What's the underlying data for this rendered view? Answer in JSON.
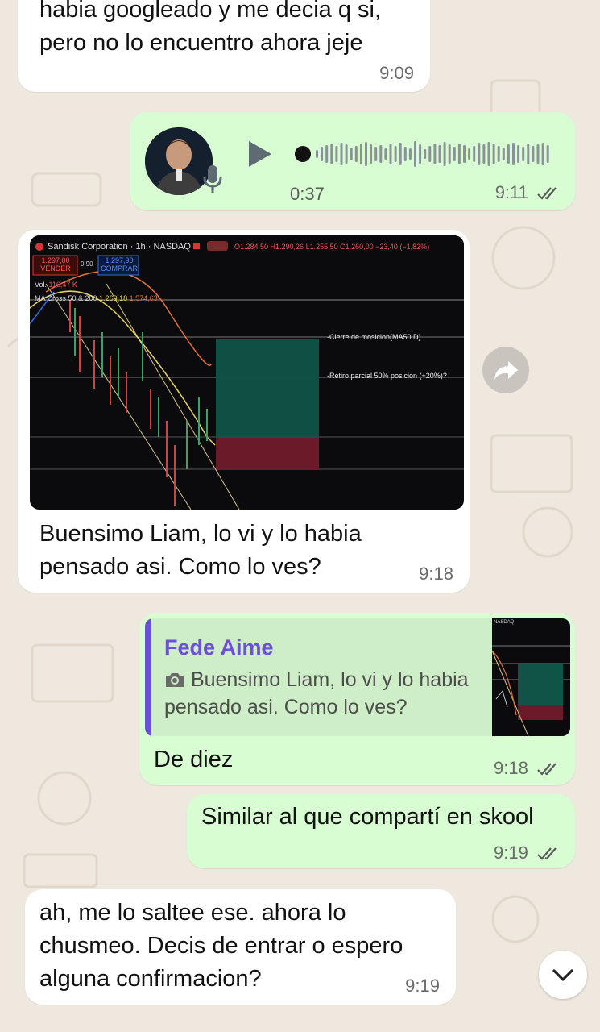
{
  "messages": {
    "m1": {
      "text_line1": "habia googleado y me decia q si,",
      "text_line2": "pero no lo encuentro ahora jeje",
      "time": "9:09"
    },
    "m2": {
      "type": "voice",
      "duration": "0:37",
      "time": "9:11"
    },
    "m3": {
      "chart": {
        "symbol": "Sandisk Corporation · 1h · NASDAQ",
        "ohlc": "O1.284,50 H1.290,26 L1.255,50 C1.260,00 −23,40 (−1,82%)",
        "sell_price": "1.297,00",
        "sell_label": "VENDER",
        "spread": "0,90",
        "buy_price": "1.297,90",
        "buy_label": "COMPRAR",
        "volume_label": "Vol.",
        "volume_value": "116,47 K",
        "ma_label": "MA Cross 50 & 200",
        "ma_value1": "1.269,18",
        "ma_value2": "1.574,63",
        "annotation1": "-Cierre de mosicion(MA50 D)",
        "annotation2": "-Retiro parcial 50% posicion (+20%)?"
      },
      "text_line1": "Buensimo Liam, lo vi y lo habia",
      "text_line2": "pensado asi. Como lo ves?",
      "time": "9:18"
    },
    "m4": {
      "quote_author": "Fede Aime",
      "quote_line1": "Buensimo Liam, lo vi y lo habia",
      "quote_line2": "pensado asi. Como lo ves?",
      "quote_thumb_label": "NASDAQ",
      "text": "De diez",
      "time": "9:18"
    },
    "m5": {
      "text": "Similar al que compartí en skool",
      "time": "9:19"
    },
    "m6": {
      "text_line1": "ah, me lo saltee ese. ahora lo",
      "text_line2": "chusmeo. Decis de entrar o espero",
      "text_line3": "alguna confirmacion?",
      "time": "9:19"
    }
  },
  "icons": [
    "play-icon",
    "microphone-icon",
    "forward-icon",
    "camera-icon",
    "chevron-down-icon",
    "read-ticks-icon"
  ],
  "colors": {
    "incoming": "#ffffff",
    "outgoing": "#d9fdd3",
    "background": "#efe8de",
    "quote_author": "#6e4fd8",
    "quote_bar": "#6e4fd8"
  }
}
